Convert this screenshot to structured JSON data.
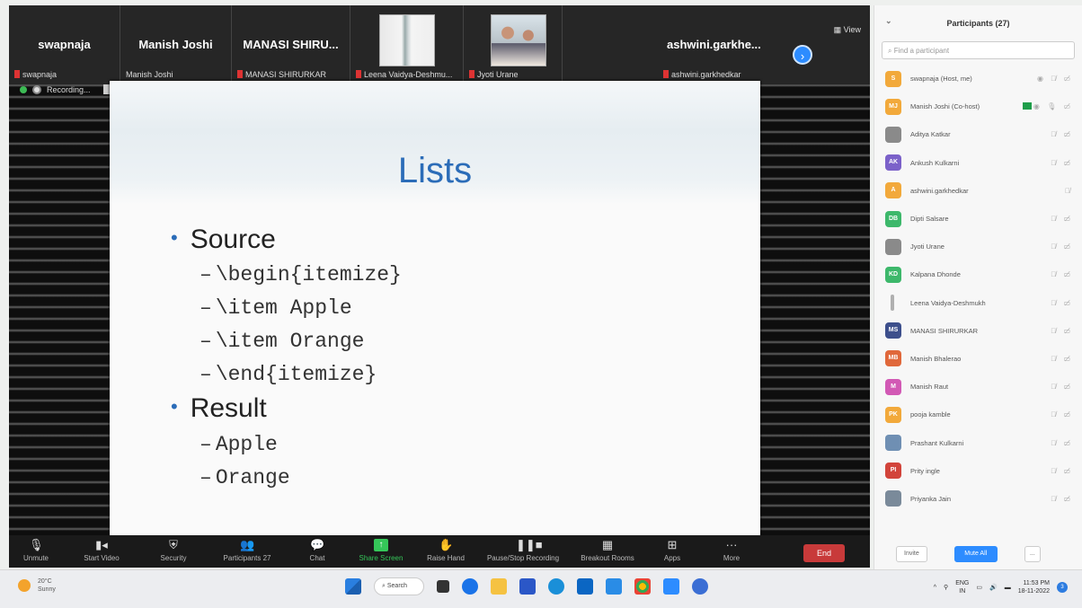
{
  "gallery": {
    "tiles": [
      {
        "name": "swapnaja",
        "label": "swapnaja"
      },
      {
        "name": "Manish Joshi",
        "label": "Manish Joshi"
      },
      {
        "name": "MANASI SHIRU...",
        "label": "MANASI SHIRURKAR"
      },
      {
        "name": "",
        "label": "Leena Vaidya-Deshmu..."
      },
      {
        "name": "",
        "label": "Jyoti Urane"
      },
      {
        "name": "ashwini.garkhe...",
        "label": "ashwini.garkhedkar"
      }
    ],
    "view_label": "View"
  },
  "recording": {
    "label": "Recording..."
  },
  "slide": {
    "title": "Lists",
    "bullets": [
      {
        "text": "Source",
        "sub": [
          "\\begin{itemize}",
          "\\item Apple",
          "\\item Orange",
          "\\end{itemize}"
        ]
      },
      {
        "text": "Result",
        "sub": [
          "Apple",
          "Orange"
        ]
      }
    ]
  },
  "toolbar": {
    "unmute": "Unmute",
    "start_video": "Start Video",
    "security": "Security",
    "participants": "Participants",
    "participants_count": "27",
    "chat": "Chat",
    "share_screen": "Share Screen",
    "raise_hand": "Raise Hand",
    "pause_recording": "Pause/Stop Recording",
    "breakout_rooms": "Breakout Rooms",
    "apps": "Apps",
    "more": "More",
    "end": "End"
  },
  "panel": {
    "title": "Participants (27)",
    "search_placeholder": "Find a participant",
    "participants": [
      {
        "initials": "S",
        "color": "#f2a93b",
        "name": "swapnaja (Host, me)"
      },
      {
        "initials": "MJ",
        "color": "#f2a93b",
        "name": "Manish Joshi (Co-host)"
      },
      {
        "initials": "",
        "color": "#8a8a8a",
        "name": "Aditya Katkar"
      },
      {
        "initials": "AK",
        "color": "#7b61c9",
        "name": "Ankush Kulkarni"
      },
      {
        "initials": "A",
        "color": "#f2a93b",
        "name": "ashwini.garkhedkar"
      },
      {
        "initials": "DB",
        "color": "#3db86b",
        "name": "Dipti Salsare"
      },
      {
        "initials": "",
        "color": "#8a8a8a",
        "name": "Jyoti Urane"
      },
      {
        "initials": "KD",
        "color": "#3db86b",
        "name": "Kalpana Dhonde"
      },
      {
        "initials": "",
        "color": "#b0b0b0",
        "name": "Leena Vaidya-Deshmukh"
      },
      {
        "initials": "MS",
        "color": "#3d4f8c",
        "name": "MANASI SHIRURKAR"
      },
      {
        "initials": "MB",
        "color": "#e0683b",
        "name": "Manish Bhalerao"
      },
      {
        "initials": "M",
        "color": "#d259b5",
        "name": "Manish Raut"
      },
      {
        "initials": "PK",
        "color": "#f2a93b",
        "name": "pooja kamble"
      },
      {
        "initials": "",
        "color": "#6f8fb3",
        "name": "Prashant Kulkarni"
      },
      {
        "initials": "PI",
        "color": "#d2443b",
        "name": "Prity ingle"
      },
      {
        "initials": "",
        "color": "#7a8a9a",
        "name": "Priyanka Jain"
      }
    ],
    "invite": "Invite",
    "mute_all": "Mute All",
    "more": "..."
  },
  "taskbar": {
    "temp": "20°C",
    "weather": "Sunny",
    "search": "Search",
    "lang1": "ENG",
    "lang2": "IN",
    "time": "11:53 PM",
    "date": "18-11-2022",
    "notif": "3"
  }
}
